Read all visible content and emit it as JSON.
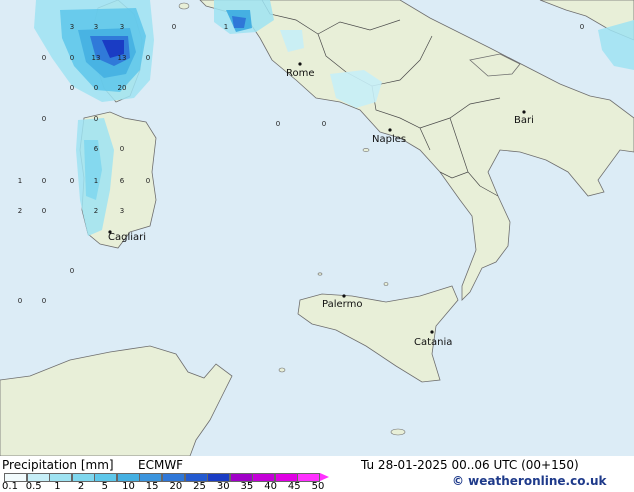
{
  "title": "Precipitation [mm]",
  "model": "ECMWF",
  "valid_time": "Tu 28-01-2025 00..06 UTC (00+150)",
  "credit": "© weatheronline.co.uk",
  "colors": {
    "sea": "#dcecf6",
    "land": "#e8efd8",
    "border": "#4a4a4a",
    "coast": "#6e6e6e"
  },
  "legend": {
    "ticks": [
      "0.1",
      "0.5",
      "1",
      "2",
      "5",
      "10",
      "15",
      "20",
      "25",
      "30",
      "35",
      "40",
      "45",
      "50"
    ],
    "colors": [
      "#f2fbfd",
      "#c6eef7",
      "#9fe3f2",
      "#7fd7ee",
      "#5ec7ea",
      "#45b0e2",
      "#3b94dd",
      "#2f77d8",
      "#235ad0",
      "#1a3cc4",
      "#a000c8",
      "#c400d8",
      "#e000e4",
      "#ff30ff"
    ]
  },
  "cities": [
    {
      "name": "Rome"
    },
    {
      "name": "Naples"
    },
    {
      "name": "Bari"
    },
    {
      "name": "Cagliari"
    },
    {
      "name": "Palermo"
    },
    {
      "name": "Catania"
    }
  ],
  "precip_values": [
    "3",
    "3",
    "3",
    "0",
    "0",
    "13",
    "13",
    "0",
    "0",
    "0",
    "20",
    "0",
    "0",
    "6",
    "0",
    "1",
    "0",
    "0",
    "1",
    "6",
    "0",
    "2",
    "0",
    "2",
    "3",
    "0",
    "0",
    "0",
    "1",
    "0",
    "0",
    "0",
    "0"
  ]
}
